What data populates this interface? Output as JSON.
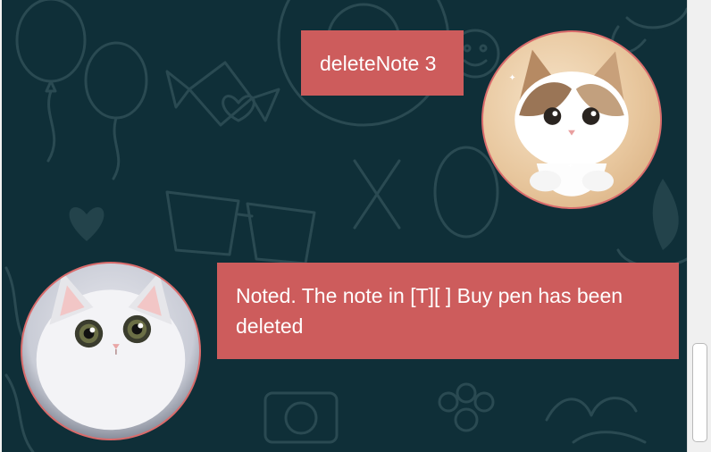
{
  "chat": {
    "messages": [
      {
        "sender": "user",
        "text": "deleteNote 3",
        "avatar": "cat-avatar-icon"
      },
      {
        "sender": "bot",
        "text": "Noted. The note in [T][ ] Buy pen has been deleted",
        "avatar": "white-cat-avatar-icon"
      }
    ]
  },
  "colors": {
    "background": "#0f2f38",
    "bubble": "#cd5c5c",
    "bubble_text": "#ffffff",
    "avatar_border": "#d96b6b"
  },
  "scrollbar": {
    "position_fraction": 1.0
  }
}
